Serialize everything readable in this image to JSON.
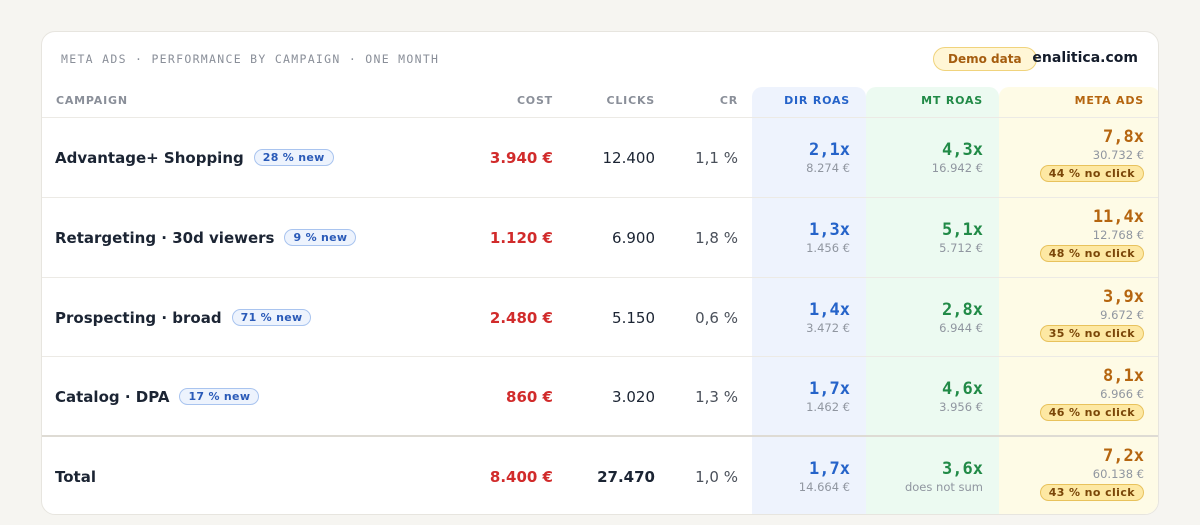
{
  "header": {
    "title": "META ADS · PERFORMANCE BY CAMPAIGN · ONE MONTH",
    "demo_badge": "Demo data",
    "brand": "enalitica.com"
  },
  "columns": {
    "campaign": "CAMPAIGN",
    "cost": "COST",
    "clicks": "CLICKS",
    "cr": "CR",
    "dir_roas": "DIR ROAS",
    "mt_roas": "MT ROAS",
    "meta_ads": "META ADS"
  },
  "colors": {
    "cost": "#d12b2b",
    "dir": "#2563c9",
    "mt": "#218a47",
    "meta": "#b5650f"
  },
  "rows": [
    {
      "campaign": "Advantage+ Shopping",
      "new_pct": "28 % new",
      "cost": "3.940 €",
      "clicks": "12.400",
      "cr": "1,1 %",
      "dir_roas": "2,1x",
      "dir_value": "8.274 €",
      "mt_roas": "4,3x",
      "mt_value": "16.942 €",
      "meta_roas": "7,8x",
      "meta_value": "30.732 €",
      "no_click": "44 % no click"
    },
    {
      "campaign": "Retargeting · 30d viewers",
      "new_pct": "9 % new",
      "cost": "1.120 €",
      "clicks": "6.900",
      "cr": "1,8 %",
      "dir_roas": "1,3x",
      "dir_value": "1.456 €",
      "mt_roas": "5,1x",
      "mt_value": "5.712 €",
      "meta_roas": "11,4x",
      "meta_value": "12.768 €",
      "no_click": "48 % no click"
    },
    {
      "campaign": "Prospecting · broad",
      "new_pct": "71 % new",
      "cost": "2.480 €",
      "clicks": "5.150",
      "cr": "0,6 %",
      "dir_roas": "1,4x",
      "dir_value": "3.472 €",
      "mt_roas": "2,8x",
      "mt_value": "6.944 €",
      "meta_roas": "3,9x",
      "meta_value": "9.672 €",
      "no_click": "35 % no click"
    },
    {
      "campaign": "Catalog · DPA",
      "new_pct": "17 % new",
      "cost": "860 €",
      "clicks": "3.020",
      "cr": "1,3 %",
      "dir_roas": "1,7x",
      "dir_value": "1.462 €",
      "mt_roas": "4,6x",
      "mt_value": "3.956 €",
      "meta_roas": "8,1x",
      "meta_value": "6.966 €",
      "no_click": "46 % no click"
    }
  ],
  "total": {
    "campaign": "Total",
    "cost": "8.400 €",
    "clicks": "27.470",
    "cr": "1,0 %",
    "dir_roas": "1,7x",
    "dir_value": "14.664 €",
    "mt_roas": "3,6x",
    "mt_value": "does not sum",
    "meta_roas": "7,2x",
    "meta_value": "60.138 €",
    "no_click": "43 % no click"
  }
}
